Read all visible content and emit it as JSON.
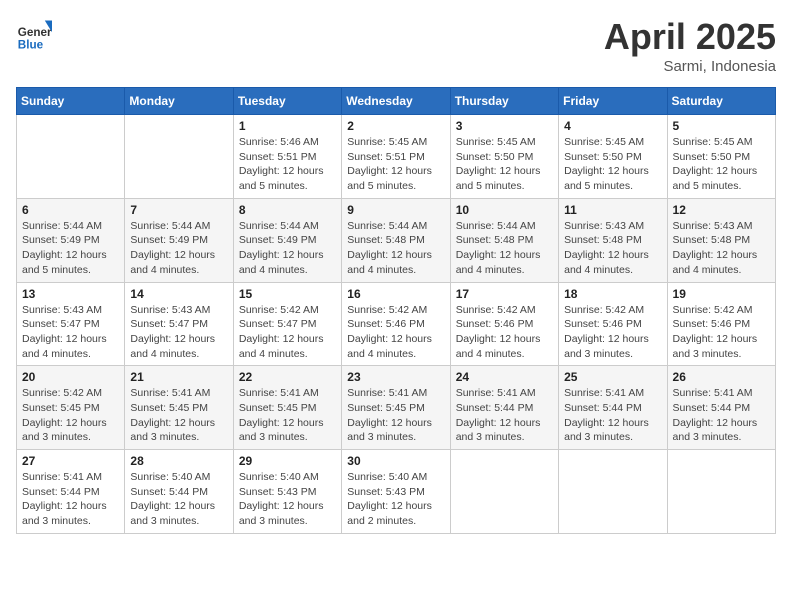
{
  "header": {
    "logo_general": "General",
    "logo_blue": "Blue",
    "month_title": "April 2025",
    "location": "Sarmi, Indonesia"
  },
  "weekdays": [
    "Sunday",
    "Monday",
    "Tuesday",
    "Wednesday",
    "Thursday",
    "Friday",
    "Saturday"
  ],
  "weeks": [
    [
      null,
      null,
      {
        "day": 1,
        "sunrise": "5:46 AM",
        "sunset": "5:51 PM",
        "daylight": "Daylight: 12 hours and 5 minutes."
      },
      {
        "day": 2,
        "sunrise": "5:45 AM",
        "sunset": "5:51 PM",
        "daylight": "Daylight: 12 hours and 5 minutes."
      },
      {
        "day": 3,
        "sunrise": "5:45 AM",
        "sunset": "5:50 PM",
        "daylight": "Daylight: 12 hours and 5 minutes."
      },
      {
        "day": 4,
        "sunrise": "5:45 AM",
        "sunset": "5:50 PM",
        "daylight": "Daylight: 12 hours and 5 minutes."
      },
      {
        "day": 5,
        "sunrise": "5:45 AM",
        "sunset": "5:50 PM",
        "daylight": "Daylight: 12 hours and 5 minutes."
      }
    ],
    [
      {
        "day": 6,
        "sunrise": "5:44 AM",
        "sunset": "5:49 PM",
        "daylight": "Daylight: 12 hours and 5 minutes."
      },
      {
        "day": 7,
        "sunrise": "5:44 AM",
        "sunset": "5:49 PM",
        "daylight": "Daylight: 12 hours and 4 minutes."
      },
      {
        "day": 8,
        "sunrise": "5:44 AM",
        "sunset": "5:49 PM",
        "daylight": "Daylight: 12 hours and 4 minutes."
      },
      {
        "day": 9,
        "sunrise": "5:44 AM",
        "sunset": "5:48 PM",
        "daylight": "Daylight: 12 hours and 4 minutes."
      },
      {
        "day": 10,
        "sunrise": "5:44 AM",
        "sunset": "5:48 PM",
        "daylight": "Daylight: 12 hours and 4 minutes."
      },
      {
        "day": 11,
        "sunrise": "5:43 AM",
        "sunset": "5:48 PM",
        "daylight": "Daylight: 12 hours and 4 minutes."
      },
      {
        "day": 12,
        "sunrise": "5:43 AM",
        "sunset": "5:48 PM",
        "daylight": "Daylight: 12 hours and 4 minutes."
      }
    ],
    [
      {
        "day": 13,
        "sunrise": "5:43 AM",
        "sunset": "5:47 PM",
        "daylight": "Daylight: 12 hours and 4 minutes."
      },
      {
        "day": 14,
        "sunrise": "5:43 AM",
        "sunset": "5:47 PM",
        "daylight": "Daylight: 12 hours and 4 minutes."
      },
      {
        "day": 15,
        "sunrise": "5:42 AM",
        "sunset": "5:47 PM",
        "daylight": "Daylight: 12 hours and 4 minutes."
      },
      {
        "day": 16,
        "sunrise": "5:42 AM",
        "sunset": "5:46 PM",
        "daylight": "Daylight: 12 hours and 4 minutes."
      },
      {
        "day": 17,
        "sunrise": "5:42 AM",
        "sunset": "5:46 PM",
        "daylight": "Daylight: 12 hours and 4 minutes."
      },
      {
        "day": 18,
        "sunrise": "5:42 AM",
        "sunset": "5:46 PM",
        "daylight": "Daylight: 12 hours and 3 minutes."
      },
      {
        "day": 19,
        "sunrise": "5:42 AM",
        "sunset": "5:46 PM",
        "daylight": "Daylight: 12 hours and 3 minutes."
      }
    ],
    [
      {
        "day": 20,
        "sunrise": "5:42 AM",
        "sunset": "5:45 PM",
        "daylight": "Daylight: 12 hours and 3 minutes."
      },
      {
        "day": 21,
        "sunrise": "5:41 AM",
        "sunset": "5:45 PM",
        "daylight": "Daylight: 12 hours and 3 minutes."
      },
      {
        "day": 22,
        "sunrise": "5:41 AM",
        "sunset": "5:45 PM",
        "daylight": "Daylight: 12 hours and 3 minutes."
      },
      {
        "day": 23,
        "sunrise": "5:41 AM",
        "sunset": "5:45 PM",
        "daylight": "Daylight: 12 hours and 3 minutes."
      },
      {
        "day": 24,
        "sunrise": "5:41 AM",
        "sunset": "5:44 PM",
        "daylight": "Daylight: 12 hours and 3 minutes."
      },
      {
        "day": 25,
        "sunrise": "5:41 AM",
        "sunset": "5:44 PM",
        "daylight": "Daylight: 12 hours and 3 minutes."
      },
      {
        "day": 26,
        "sunrise": "5:41 AM",
        "sunset": "5:44 PM",
        "daylight": "Daylight: 12 hours and 3 minutes."
      }
    ],
    [
      {
        "day": 27,
        "sunrise": "5:41 AM",
        "sunset": "5:44 PM",
        "daylight": "Daylight: 12 hours and 3 minutes."
      },
      {
        "day": 28,
        "sunrise": "5:40 AM",
        "sunset": "5:44 PM",
        "daylight": "Daylight: 12 hours and 3 minutes."
      },
      {
        "day": 29,
        "sunrise": "5:40 AM",
        "sunset": "5:43 PM",
        "daylight": "Daylight: 12 hours and 3 minutes."
      },
      {
        "day": 30,
        "sunrise": "5:40 AM",
        "sunset": "5:43 PM",
        "daylight": "Daylight: 12 hours and 2 minutes."
      },
      null,
      null,
      null
    ]
  ]
}
